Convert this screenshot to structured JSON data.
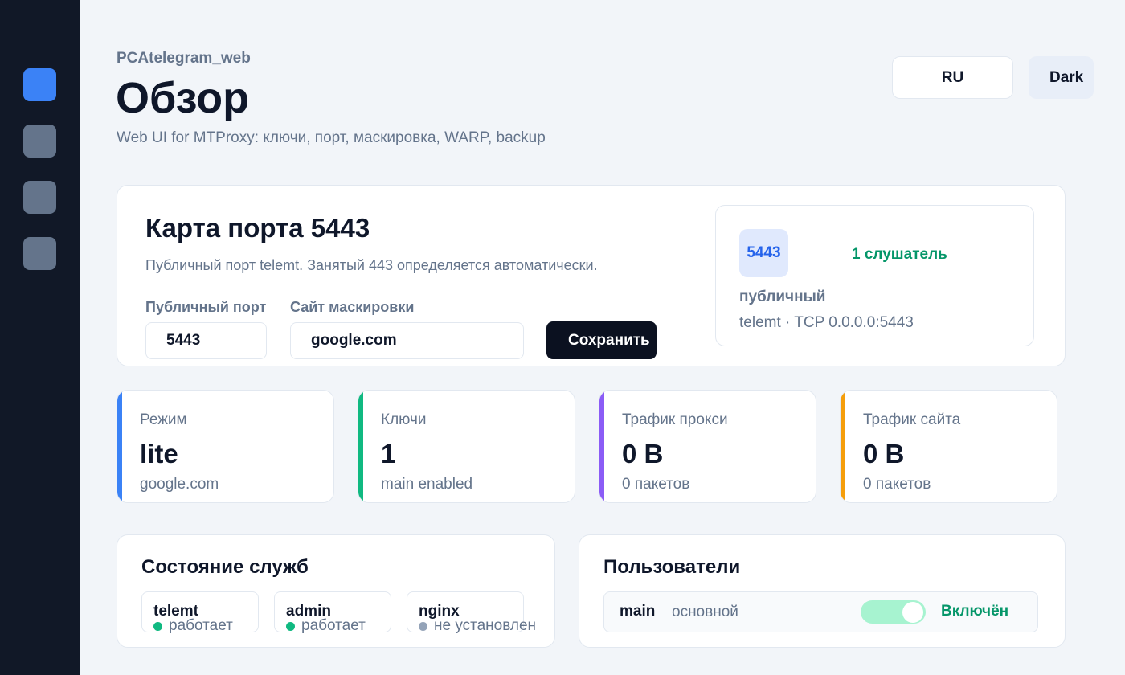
{
  "sidebar": {
    "items": [
      {
        "icon": "overview-icon",
        "active": true
      },
      {
        "icon": "keys-icon",
        "active": false
      },
      {
        "icon": "settings-icon",
        "active": false
      },
      {
        "icon": "backup-icon",
        "active": false
      }
    ]
  },
  "header": {
    "app_name": "PCAtelegram_web",
    "title": "Обзор",
    "subtitle": "Web UI for MTProxy: ключи, порт, маскировка, WARP, backup",
    "lang_label": "RU",
    "theme_label": "Dark"
  },
  "port_card": {
    "title": "Карта порта 5443",
    "description": "Публичный порт telemt. Занятый 443 определяется автоматически.",
    "port_label": "Публичный порт",
    "port_value": "5443",
    "site_label": "Сайт маскировки",
    "site_value": "google.com",
    "save_label": "Сохранить",
    "info": {
      "badge": "5443",
      "listeners": "1 слушатель",
      "kind": "публичный",
      "address": "telemt · TCP 0.0.0.0:5443"
    }
  },
  "stats": [
    {
      "label": "Режим",
      "value": "lite",
      "sub": "google.com",
      "color": "#3b82f6"
    },
    {
      "label": "Ключи",
      "value": "1",
      "sub": "main enabled",
      "color": "#10b981"
    },
    {
      "label": "Трафик прокси",
      "value": "0 B",
      "sub": "0 пакетов",
      "color": "#8b5cf6"
    },
    {
      "label": "Трафик сайта",
      "value": "0 B",
      "sub": "0 пакетов",
      "color": "#f59e0b"
    }
  ],
  "services": {
    "title": "Состояние служб",
    "items": [
      {
        "name": "telemt",
        "status": "работает",
        "color": "#10b981"
      },
      {
        "name": "admin",
        "status": "работает",
        "color": "#10b981"
      },
      {
        "name": "nginx",
        "status": "не установлен",
        "color": "#94a3b8"
      }
    ]
  },
  "users": {
    "title": "Пользователи",
    "items": [
      {
        "name": "main",
        "role": "основной",
        "state": "Включён",
        "enabled": true
      }
    ]
  },
  "colors": {
    "accent": "#3b82f6",
    "success": "#059669",
    "sidebar": "#111827"
  }
}
